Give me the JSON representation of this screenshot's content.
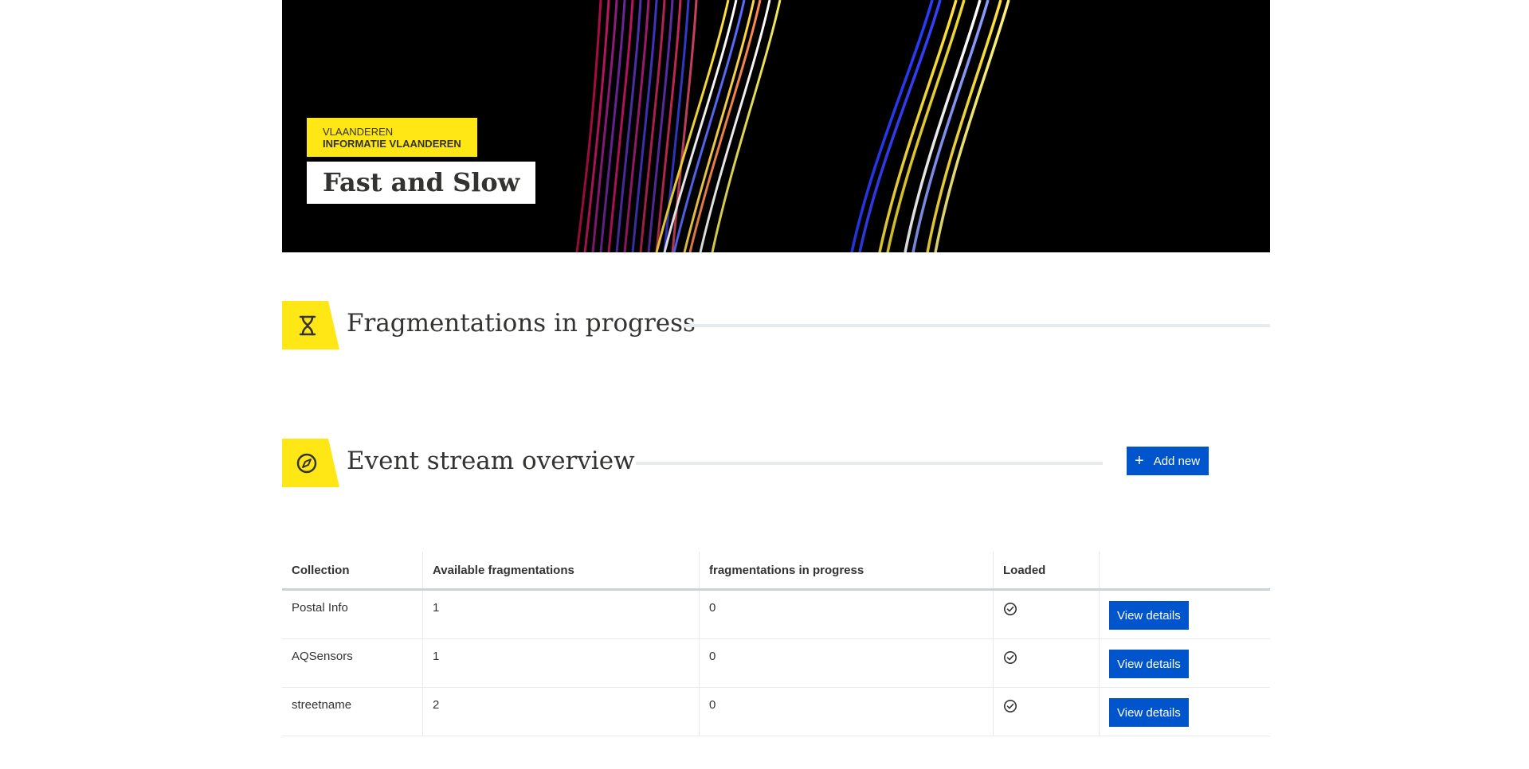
{
  "hero": {
    "org_top": "VLAANDEREN",
    "org_bottom": "INFORMATIE VLAANDEREN",
    "title": "Fast and Slow"
  },
  "sections": {
    "progress": {
      "title": "Fragmentations in progress",
      "icon": "hourglass-icon"
    },
    "overview": {
      "title": "Event stream overview",
      "icon": "compass-icon",
      "add_label": "Add new"
    }
  },
  "table": {
    "headers": [
      "Collection",
      "Available fragmentations",
      "fragmentations in progress",
      "Loaded",
      ""
    ],
    "rows": [
      {
        "collection": "Postal Info",
        "available": "1",
        "in_progress": "0",
        "loaded": true,
        "action": "View details"
      },
      {
        "collection": "AQSensors",
        "available": "1",
        "in_progress": "0",
        "loaded": true,
        "action": "View details"
      },
      {
        "collection": "streetname",
        "available": "2",
        "in_progress": "0",
        "loaded": true,
        "action": "View details"
      }
    ]
  },
  "colors": {
    "accent_yellow": "#ffe615",
    "primary_blue": "#0055cc",
    "text": "#333332"
  }
}
